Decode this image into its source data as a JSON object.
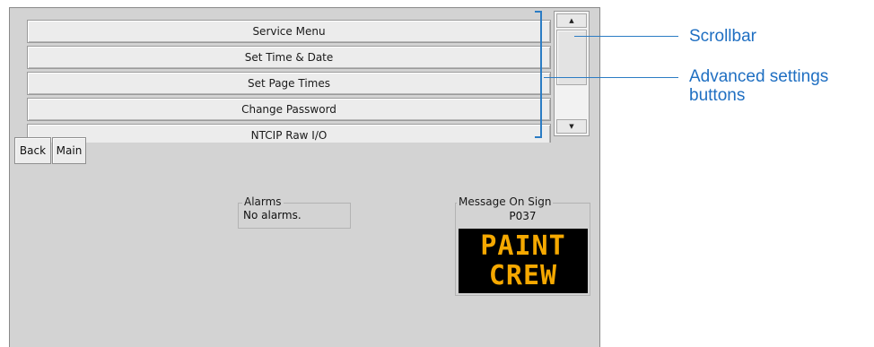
{
  "menu": {
    "items": [
      {
        "label": "Service Menu"
      },
      {
        "label": "Set Time & Date"
      },
      {
        "label": "Set Page Times"
      },
      {
        "label": "Change Password"
      },
      {
        "label": "NTCIP Raw I/O"
      }
    ]
  },
  "scrollbar": {
    "up_icon": "▲",
    "down_icon": "▼"
  },
  "nav": {
    "back_label": "Back",
    "main_label": "Main"
  },
  "alarms": {
    "title": "Alarms",
    "status": "No alarms."
  },
  "message_on_sign": {
    "title": "Message On Sign",
    "code": "P037",
    "lines": [
      "PAINT",
      "CREW"
    ],
    "text_color": "#f5a800"
  },
  "callouts": {
    "scrollbar": "Scrollbar",
    "advanced_line1": "Advanced settings",
    "advanced_line2": "buttons",
    "color": "#1f6fc2"
  }
}
